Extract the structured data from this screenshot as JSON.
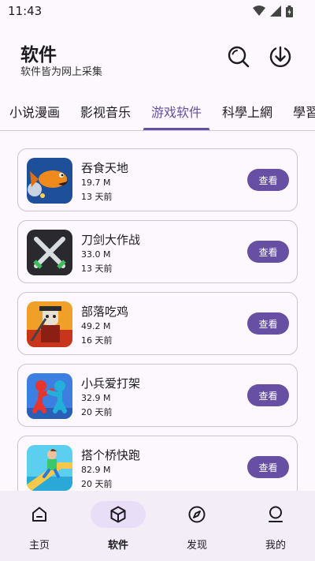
{
  "status_bar": {
    "time": "11:43",
    "icons": [
      "wifi-icon",
      "signal-icon",
      "battery-icon"
    ]
  },
  "header": {
    "title": "软件",
    "subtitle": "软件皆为网上采集",
    "actions": [
      "search-icon",
      "download-icon"
    ]
  },
  "tabs": [
    {
      "label": "小说漫画",
      "active": false
    },
    {
      "label": "影视音乐",
      "active": false
    },
    {
      "label": "游戏软件",
      "active": true
    },
    {
      "label": "科學上網",
      "active": false
    },
    {
      "label": "學習",
      "active": false
    }
  ],
  "apps": [
    {
      "name": "吞食天地",
      "size": "19.7 M",
      "date": "13 天前",
      "button": "查看",
      "icon": "fish-game-icon"
    },
    {
      "name": "刀剑大作战",
      "size": "33.0 M",
      "date": "13 天前",
      "button": "查看",
      "icon": "crossed-swords-icon"
    },
    {
      "name": "部落吃鸡",
      "size": "49.2 M",
      "date": "16 天前",
      "button": "查看",
      "icon": "warrior-game-icon"
    },
    {
      "name": "小兵爱打架",
      "size": "32.9 M",
      "date": "20 天前",
      "button": "查看",
      "icon": "stickman-fight-icon"
    },
    {
      "name": "搭个桥快跑",
      "size": "82.9 M",
      "date": "20 天前",
      "button": "查看",
      "icon": "bridge-runner-icon"
    }
  ],
  "bottom_nav": [
    {
      "label": "主页",
      "icon": "home-icon",
      "active": false
    },
    {
      "label": "软件",
      "icon": "cube-icon",
      "active": true
    },
    {
      "label": "发现",
      "icon": "compass-icon",
      "active": false
    },
    {
      "label": "我的",
      "icon": "user-icon",
      "active": false
    }
  ],
  "colors": {
    "accent": "#6750a4",
    "background": "#fdf8fd",
    "nav_background": "#f3edf7",
    "active_pill": "#e8def8"
  }
}
